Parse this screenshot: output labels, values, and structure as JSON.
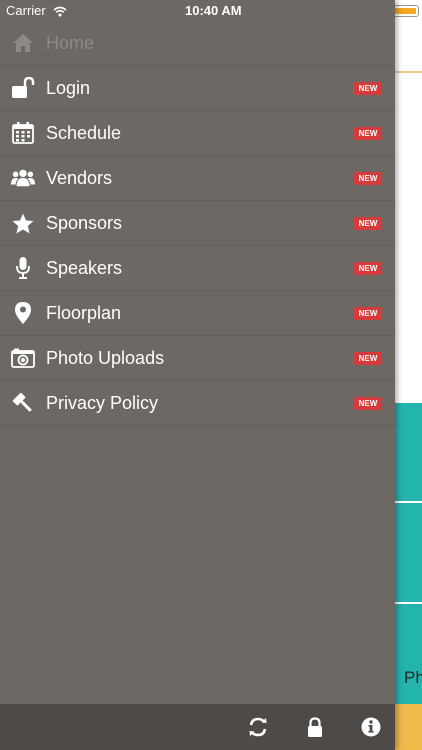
{
  "status_bar": {
    "carrier": "Carrier",
    "time": "10:40 AM"
  },
  "menu": {
    "items": [
      {
        "label": "Home",
        "icon": "home-icon",
        "badge": ""
      },
      {
        "label": "Login",
        "icon": "unlock-icon",
        "badge": "NEW"
      },
      {
        "label": "Schedule",
        "icon": "calendar-icon",
        "badge": "NEW"
      },
      {
        "label": "Vendors",
        "icon": "users-icon",
        "badge": "NEW"
      },
      {
        "label": "Sponsors",
        "icon": "star-icon",
        "badge": "NEW"
      },
      {
        "label": "Speakers",
        "icon": "microphone-icon",
        "badge": "NEW"
      },
      {
        "label": "Floorplan",
        "icon": "map-pin-icon",
        "badge": "NEW"
      },
      {
        "label": "Photo Uploads",
        "icon": "camera-icon",
        "badge": "NEW"
      },
      {
        "label": "Privacy Policy",
        "icon": "gavel-icon",
        "badge": "NEW"
      }
    ]
  },
  "toolbar": {
    "icons": [
      "refresh-icon",
      "lock-icon",
      "info-icon"
    ]
  },
  "background_content": {
    "peek_text": "Ph"
  },
  "colors": {
    "drawer_bg": "#6d6863",
    "toolbar_bg": "#4e4a47",
    "badge_red": "#d63b3b",
    "teal": "#24b3ad",
    "orange": "#f0b94a"
  }
}
